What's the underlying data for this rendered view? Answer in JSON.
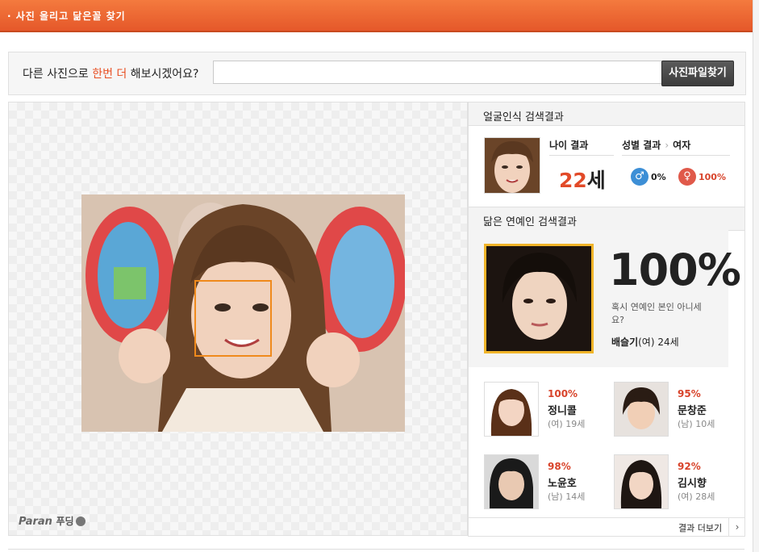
{
  "header": {
    "title": "· 사진 올리고 닮은꼴 찾기"
  },
  "search": {
    "prompt_before": "다른 사진으로 ",
    "prompt_highlight": "한번 더",
    "prompt_after": " 해보시겠어요?",
    "input_value": "",
    "find_button": "사진파일찾기"
  },
  "brand": {
    "name": "Paran",
    "service": "푸딩"
  },
  "face_result": {
    "heading": "얼굴인식 검색결과",
    "age_label": "나이 결과",
    "age_value": "22",
    "age_unit": "세",
    "gender_label": "성별 결과",
    "gender_arrow": "›",
    "gender_value": "여자",
    "male_percent": "0%",
    "female_percent": "100%"
  },
  "celebrity": {
    "heading": "닮은 연예인 검색결과",
    "top_percent": "100%",
    "top_question": "혹시 연예인 본인 아니세요?",
    "top_name": "배슬기",
    "top_info": "(여) 24세",
    "similar": [
      {
        "percent": "100%",
        "name": "정니콜",
        "info": "(여) 19세"
      },
      {
        "percent": "95%",
        "name": "문창준",
        "info": "(남) 10세"
      },
      {
        "percent": "98%",
        "name": "노윤호",
        "info": "(남) 14세"
      },
      {
        "percent": "92%",
        "name": "김시향",
        "info": "(여) 28세"
      }
    ],
    "more_button": "결과 더보기",
    "more_arrow": "›"
  },
  "icons": [
    "male-icon",
    "female-icon",
    "chevron-right-icon",
    "pudding-logo-icon"
  ],
  "colors": {
    "accent": "#e8572a",
    "highlight": "#e84f22",
    "percent_red": "#d8432a",
    "face_box": "#f08a1c",
    "top_frame": "#f0b429"
  }
}
